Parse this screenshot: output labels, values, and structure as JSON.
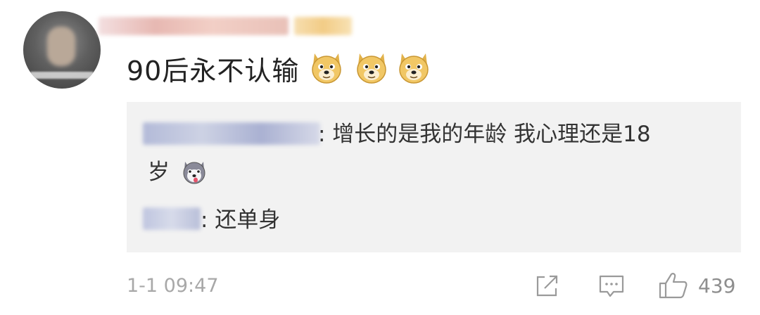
{
  "comment": {
    "text": "90后永不认输",
    "emoji_names": [
      "doge-emoji",
      "doge-emoji",
      "doge-emoji"
    ]
  },
  "replies": [
    {
      "text": ": 增长的是我的年龄 我心理还是18",
      "text_cont": "岁",
      "emoji": "husky-emoji"
    },
    {
      "text": ": 还单身"
    }
  ],
  "footer": {
    "time": "1-1 09:47",
    "like_count": "439",
    "icons": [
      "share-icon",
      "comment-icon",
      "like-icon"
    ]
  },
  "colors": {
    "text": "#222222",
    "reply_bg": "#f2f2f2",
    "meta": "#a8a8a8"
  }
}
